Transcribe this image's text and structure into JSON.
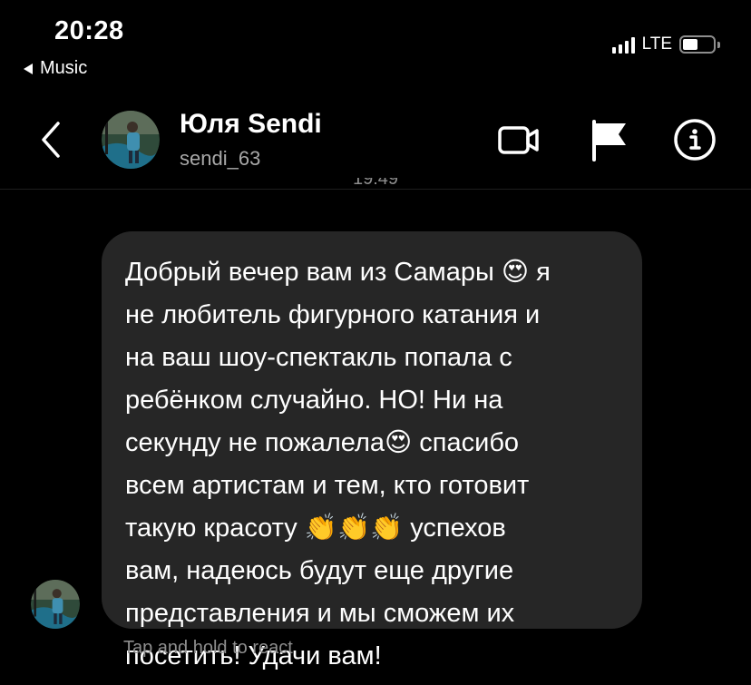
{
  "status_bar": {
    "time": "20:28",
    "back_app": "Music",
    "network": "LTE",
    "battery_level": 0.5
  },
  "header": {
    "name": "Юля Sendi",
    "username": "sendi_63",
    "icons": [
      "back-chevron-icon",
      "video-camera-icon",
      "flag-icon",
      "info-icon"
    ]
  },
  "conversation": {
    "timestamp": "19:49",
    "message": "Добрый вечер вам из Самары 😍 я\nне любитель фигурного катания и\nна ваш шоу-спектакль попала с\nребёнком случайно. НО! Ни на\nсекунду не пожалела😍 спасибо\nвсем артистам и тем, кто готовит\nтакую красоту 👏👏👏 успехов\nвам, надеюсь будут еще другие\nпредставления и мы сможем их\nпосетить! Удачи вам!",
    "hint": "Tap and hold to react"
  },
  "colors": {
    "background": "#000000",
    "bubble": "#262626",
    "secondary_text": "#8e8e8e"
  }
}
